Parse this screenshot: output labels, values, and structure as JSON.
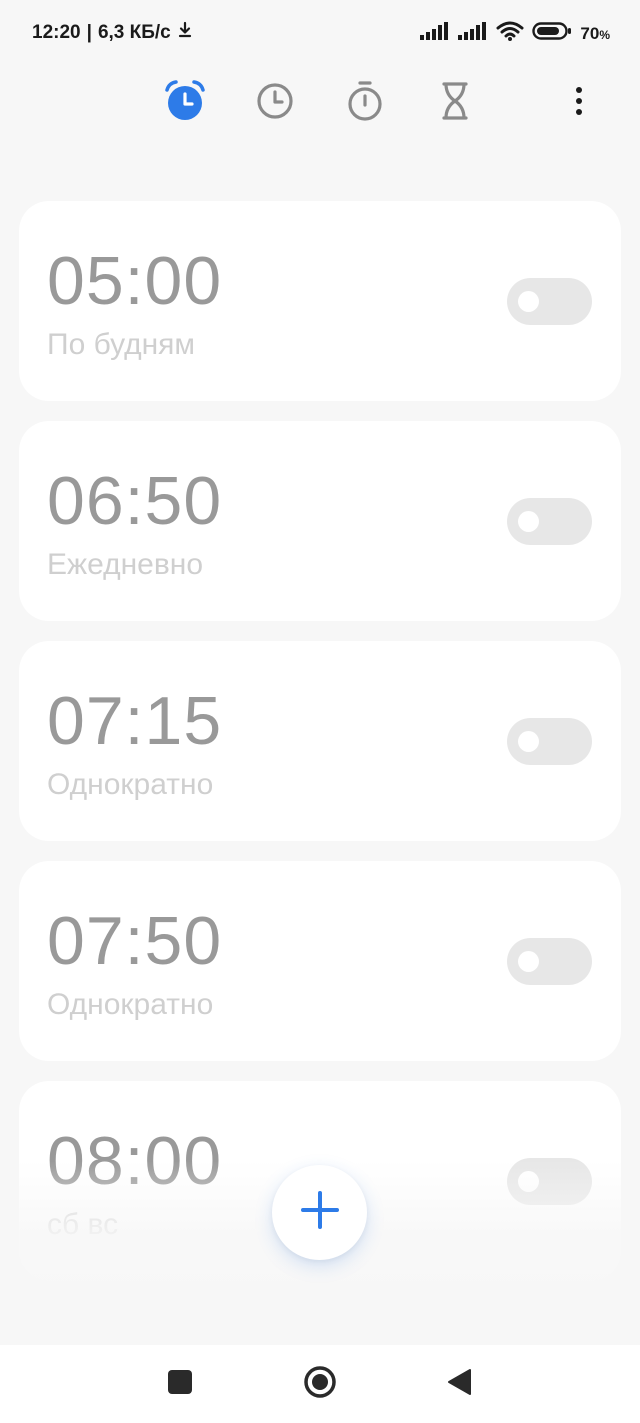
{
  "status_bar": {
    "time": "12:20",
    "separator": "|",
    "network_speed": "6,3 КБ/с",
    "battery_percent": "70",
    "battery_sign": "%"
  },
  "tabs": [
    {
      "name": "alarm",
      "icon": "alarm-clock-icon",
      "active": true
    },
    {
      "name": "world-clock",
      "icon": "clock-icon",
      "active": false
    },
    {
      "name": "stopwatch",
      "icon": "stopwatch-icon",
      "active": false
    },
    {
      "name": "timer",
      "icon": "hourglass-icon",
      "active": false
    }
  ],
  "alarms": [
    {
      "time": "05:00",
      "repeat": "По будням",
      "enabled": false
    },
    {
      "time": "06:50",
      "repeat": "Ежедневно",
      "enabled": false
    },
    {
      "time": "07:15",
      "repeat": "Однократно",
      "enabled": false
    },
    {
      "time": "07:50",
      "repeat": "Однократно",
      "enabled": false
    },
    {
      "time": "08:00",
      "repeat": "сб вс",
      "enabled": false
    }
  ],
  "colors": {
    "accent": "#2d7be8",
    "background": "#f7f7f7",
    "card": "#ffffff",
    "time_text": "#999999",
    "repeat_text": "#cfcfcf",
    "toggle_off": "#e7e7e7"
  }
}
